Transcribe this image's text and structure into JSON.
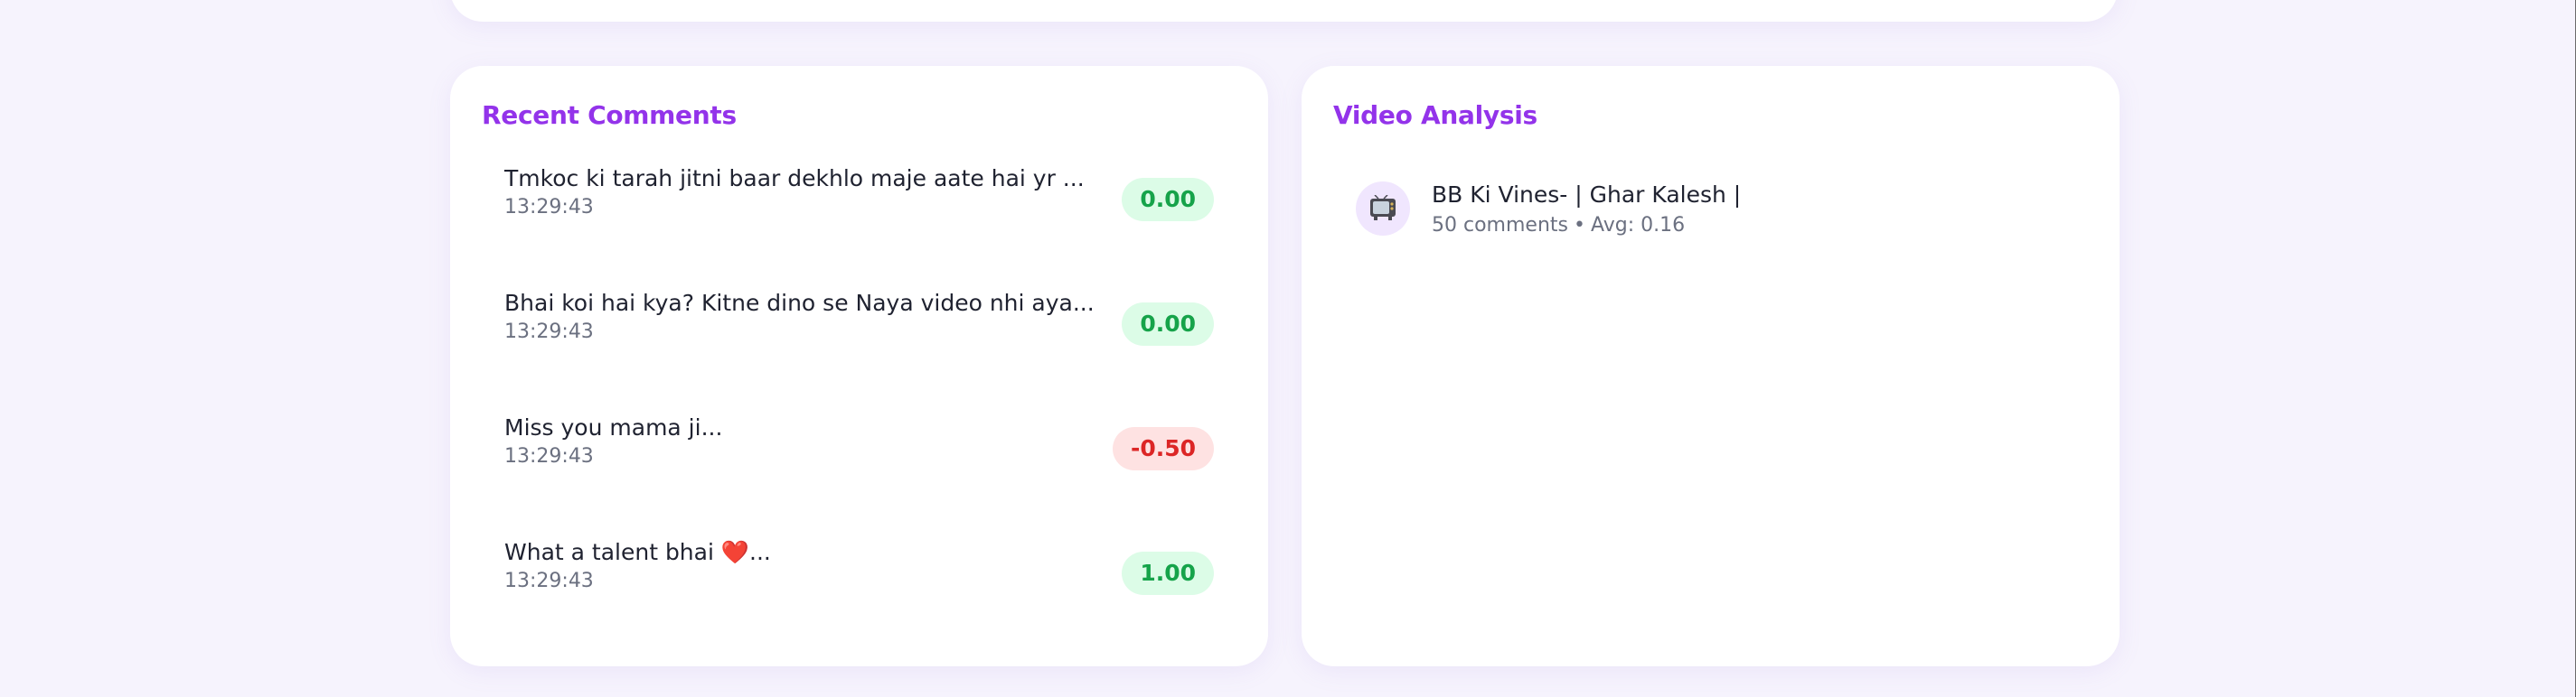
{
  "recent_comments": {
    "title": "Recent Comments",
    "items": [
      {
        "text": "Tmkoc ki tarah jitni baar dekhlo maje aate hai yr ...",
        "time": "13:29:43",
        "score": "0.00",
        "sentiment": "positive"
      },
      {
        "text": "Bhai koi hai kya? Kitne dino se Naya video nhi aya...",
        "time": "13:29:43",
        "score": "0.00",
        "sentiment": "positive"
      },
      {
        "text": "Miss you mama ji...",
        "time": "13:29:43",
        "score": "-0.50",
        "sentiment": "negative"
      },
      {
        "text": "What a talent bhai ❤️...",
        "time": "13:29:43",
        "score": "1.00",
        "sentiment": "positive"
      }
    ]
  },
  "video_analysis": {
    "title": "Video Analysis",
    "video": {
      "icon": "tv-icon",
      "title": "BB Ki Vines- | Ghar Kalesh |",
      "comments": "50 comments",
      "separator": "•",
      "avg": "Avg: 0.16"
    }
  },
  "colors": {
    "accent": "#9333ea",
    "positive_text": "#16a34a",
    "positive_bg": "#dcfce7",
    "negative_text": "#dc2626",
    "negative_bg": "#fee2e2",
    "page_bg": "#f6f3fd"
  }
}
